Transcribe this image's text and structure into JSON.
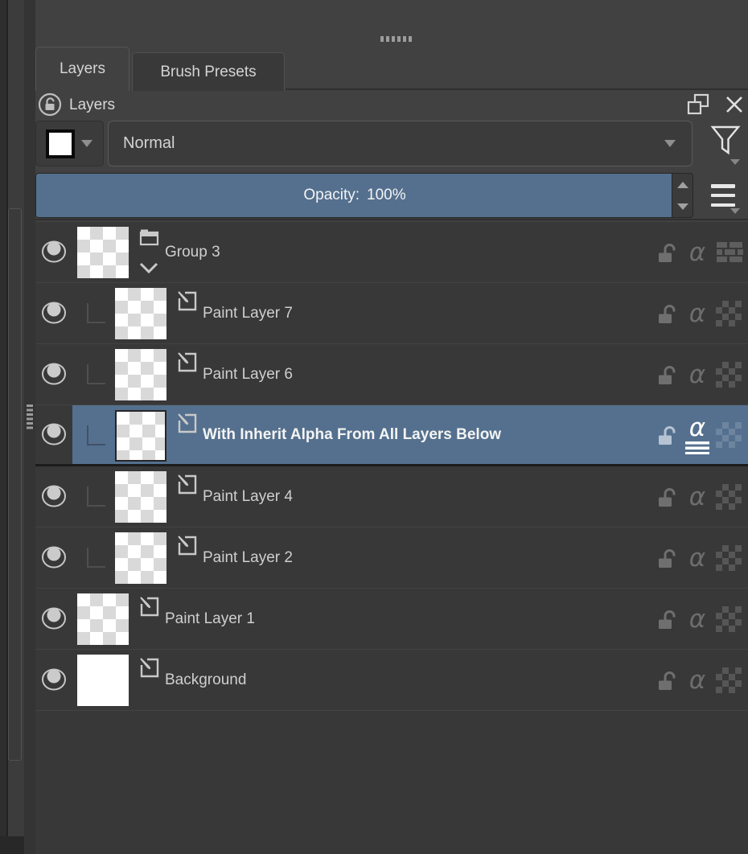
{
  "window": {
    "top_drag_handle": "dotted-drag-handle",
    "left_splitter_handle": "dotted-splitter-handle"
  },
  "tabs": [
    {
      "label": "Layers",
      "active": true
    },
    {
      "label": "Brush Presets",
      "active": false
    }
  ],
  "docker": {
    "title": "Layers",
    "title_icon": "lock-circle-icon",
    "float_icon": "float-docker-icon",
    "close_icon": "close-icon"
  },
  "blend": {
    "value": "Normal"
  },
  "opacity": {
    "label": "Opacity:",
    "value": "100%",
    "percent": 100
  },
  "toolbar_icons": {
    "color_label": "color-label-swatch",
    "filter": "filter-funnel-icon",
    "menu": "hamburger-menu-icon"
  },
  "colors": {
    "selection_blue": "#54708e",
    "panel_bg": "#414141",
    "list_bg": "#383838",
    "text": "#cfcfcf"
  },
  "layers": [
    {
      "name": "Group 3",
      "type": "group",
      "indent": 0,
      "selected": false,
      "expanded": true,
      "visible": true,
      "thumb": "checker",
      "right_icon": "bricks",
      "inherit_alpha": false
    },
    {
      "name": "Paint Layer 7",
      "type": "paint",
      "indent": 1,
      "selected": false,
      "visible": true,
      "thumb": "checker",
      "right_icon": "checker",
      "inherit_alpha": false
    },
    {
      "name": "Paint Layer 6",
      "type": "paint",
      "indent": 1,
      "selected": false,
      "visible": true,
      "thumb": "checker",
      "right_icon": "checker",
      "inherit_alpha": false
    },
    {
      "name": "With Inherit Alpha From All Layers Below",
      "type": "paint",
      "indent": 1,
      "selected": true,
      "visible": true,
      "thumb": "checker",
      "right_icon": "checker",
      "inherit_alpha": true
    },
    {
      "name": "Paint Layer 4",
      "type": "paint",
      "indent": 1,
      "selected": false,
      "visible": true,
      "thumb": "checker",
      "right_icon": "checker",
      "inherit_alpha": false
    },
    {
      "name": "Paint Layer 2",
      "type": "paint",
      "indent": 1,
      "selected": false,
      "visible": true,
      "thumb": "checker",
      "right_icon": "checker",
      "inherit_alpha": false
    },
    {
      "name": "Paint Layer 1",
      "type": "paint",
      "indent": 0,
      "selected": false,
      "visible": true,
      "thumb": "checker",
      "right_icon": "checker",
      "inherit_alpha": false
    },
    {
      "name": "Background",
      "type": "paint",
      "indent": 0,
      "selected": false,
      "visible": true,
      "thumb": "solid",
      "right_icon": "checker",
      "inherit_alpha": false
    }
  ]
}
